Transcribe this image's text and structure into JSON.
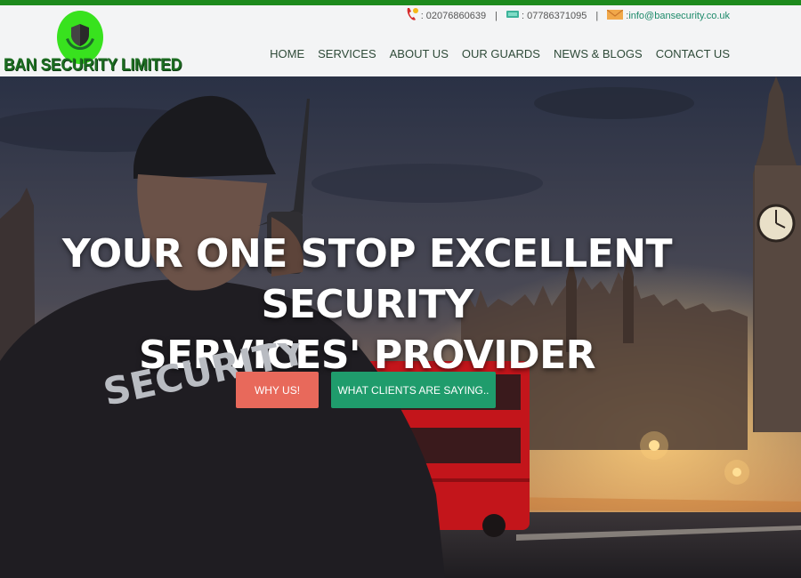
{
  "brand": {
    "name": "BAN SECURITY LIMITED",
    "accent": "#1d8a1d",
    "logo_circle": "#38e21e"
  },
  "contact": {
    "phone_icon": "phone-icon",
    "phone": ": 02076860639",
    "mobile_icon": "mobile-icon",
    "mobile": ": 07786371095",
    "email_icon": "envelope-icon",
    "email_prefix": ": ",
    "email": "info@bansecurity.co.uk",
    "separator": "|"
  },
  "nav": {
    "items": [
      "HOME",
      "SERVICES",
      "ABOUT US",
      "OUR GUARDS",
      "NEWS & BLOGS",
      "CONTACT US"
    ]
  },
  "hero": {
    "title_line1": "YOUR ONE STOP EXCELLENT SECURITY",
    "title_line2": "SERVICES' PROVIDER",
    "jacket_text": "SECURITY",
    "buttons": {
      "why_us": "WHY US!",
      "clients": "WHAT CLIENTS ARE SAYING.."
    },
    "colors": {
      "why_us": "#e8695b",
      "clients": "#1f9c6c"
    }
  }
}
